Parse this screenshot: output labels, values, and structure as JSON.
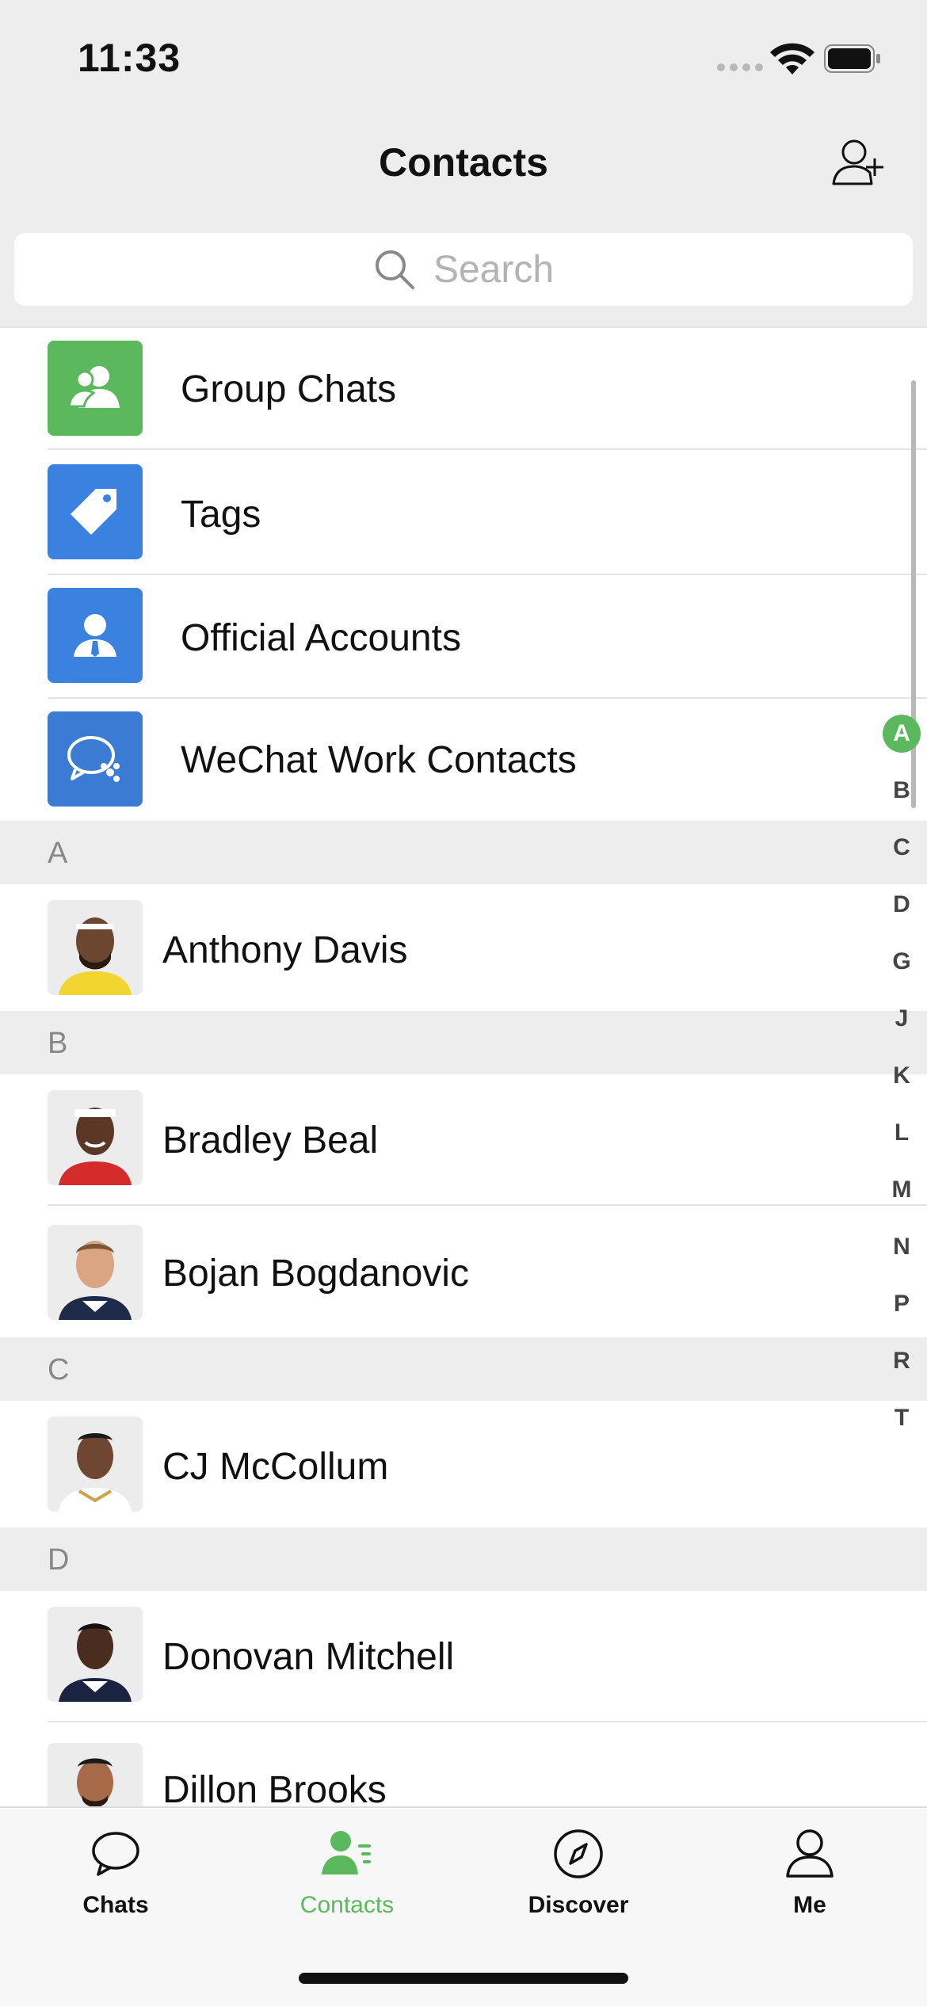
{
  "status_bar": {
    "time": "11:33"
  },
  "header": {
    "title": "Contacts"
  },
  "search": {
    "placeholder": "Search"
  },
  "functions": [
    {
      "label": "Group Chats",
      "icon": "group-chats-icon",
      "color": "#5cb85c"
    },
    {
      "label": "Tags",
      "icon": "tag-icon",
      "color": "#3b82e0"
    },
    {
      "label": "Official Accounts",
      "icon": "official-accounts-icon",
      "color": "#3b82e0"
    },
    {
      "label": "WeChat Work Contacts",
      "icon": "wechat-work-icon",
      "color": "#3b7bd4"
    }
  ],
  "sections": [
    {
      "letter": "A",
      "contacts": [
        "Anthony Davis"
      ]
    },
    {
      "letter": "B",
      "contacts": [
        "Bradley Beal",
        "Bojan Bogdanovic"
      ]
    },
    {
      "letter": "C",
      "contacts": [
        "CJ McCollum"
      ]
    },
    {
      "letter": "D",
      "contacts": [
        "Donovan Mitchell",
        "Dillon Brooks"
      ]
    }
  ],
  "index_letters": [
    "A",
    "B",
    "C",
    "D",
    "G",
    "J",
    "K",
    "L",
    "M",
    "N",
    "P",
    "R",
    "T"
  ],
  "index_active": "A",
  "tabs": [
    {
      "label": "Chats",
      "icon": "chat-bubble-icon",
      "active": false
    },
    {
      "label": "Contacts",
      "icon": "contacts-icon",
      "active": true
    },
    {
      "label": "Discover",
      "icon": "compass-icon",
      "active": false
    },
    {
      "label": "Me",
      "icon": "person-icon",
      "active": false
    }
  ],
  "colors": {
    "accent": "#5cb85c",
    "background": "#ededed",
    "blue": "#3b82e0"
  }
}
